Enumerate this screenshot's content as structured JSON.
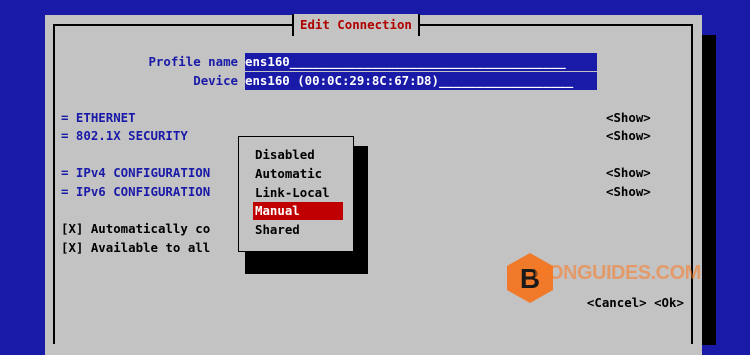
{
  "dialog": {
    "title": "Edit Connection"
  },
  "form": {
    "profile_name_label": "Profile name",
    "profile_name_value": "ens160_____________________________________",
    "device_label": "Device",
    "device_value": "ens160 (00:0C:29:8C:67:D8)__________________"
  },
  "sections": [
    {
      "label": "= ETHERNET",
      "action": "<Show>"
    },
    {
      "label": "= 802.1X SECURITY",
      "action": "<Show>"
    },
    {
      "label": "= IPv4 CONFIGURATION",
      "action": "<Show>"
    },
    {
      "label": "= IPv6 CONFIGURATION",
      "action": "<Show>"
    }
  ],
  "checkboxes": [
    {
      "text": "[X] Automatically co"
    },
    {
      "text": "[X] Available to all"
    }
  ],
  "popup": {
    "options": [
      "Disabled",
      "Automatic",
      "Link-Local",
      "Manual",
      "Shared"
    ],
    "selected": "Manual"
  },
  "buttons": {
    "cancel": "<Cancel>",
    "ok": "<Ok>"
  },
  "watermark": {
    "letter": "B",
    "text": "BONGUIDES.COM"
  },
  "colors": {
    "background": "#1a1aa8",
    "dialog": "#c3c3c3",
    "title": "#b00000",
    "selection": "#c00000",
    "watermark": "#f07a2a"
  }
}
